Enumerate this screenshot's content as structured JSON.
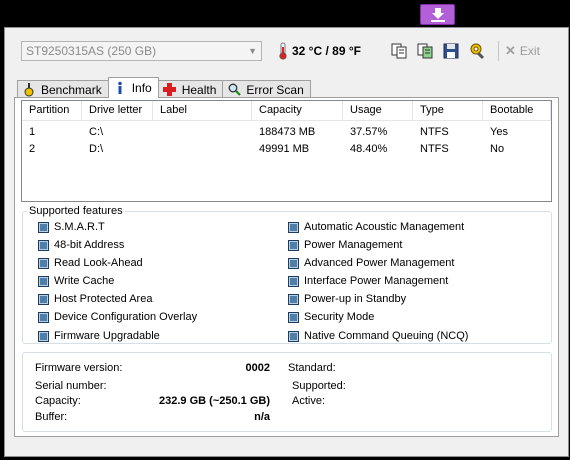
{
  "drive": {
    "selected": "ST9250315AS (250 GB)"
  },
  "temperature": {
    "text": "32 °C / 89 °F"
  },
  "toolbar": {
    "exit_label": "Exit"
  },
  "tabs": [
    {
      "label": "Benchmark",
      "icon": "stopwatch-icon",
      "active": false
    },
    {
      "label": "Info",
      "icon": "info-icon",
      "active": true
    },
    {
      "label": "Health",
      "icon": "health-cross-icon",
      "active": false
    },
    {
      "label": "Error Scan",
      "icon": "magnifier-icon",
      "active": false
    }
  ],
  "partitions": {
    "columns": [
      "Partition",
      "Drive letter",
      "Label",
      "Capacity",
      "Usage",
      "Type",
      "Bootable"
    ],
    "rows": [
      [
        "1",
        "C:\\",
        "",
        "188473 MB",
        "37.57%",
        "NTFS",
        "Yes"
      ],
      [
        "2",
        "D:\\",
        "",
        "49991 MB",
        "48.40%",
        "NTFS",
        "No"
      ]
    ]
  },
  "features": {
    "title": "Supported features",
    "left": [
      "S.M.A.R.T",
      "48-bit Address",
      "Read Look-Ahead",
      "Write Cache",
      "Host Protected Area",
      "Device Configuration Overlay",
      "Firmware Upgradable"
    ],
    "right": [
      "Automatic Acoustic Management",
      "Power Management",
      "Advanced Power Management",
      "Interface Power Management",
      "Power-up in Standby",
      "Security Mode",
      "Native Command Queuing (NCQ)"
    ]
  },
  "details": {
    "firmware_label": "Firmware version:",
    "firmware_value": "0002",
    "serial_label": "Serial number:",
    "serial_value": "",
    "capacity_label": "Capacity:",
    "capacity_value": "232.9 GB (~250.1 GB)",
    "buffer_label": "Buffer:",
    "buffer_value": "n/a",
    "standard_label": "Standard:",
    "supported_label": "Supported:",
    "active_label": "Active:"
  },
  "colors": {
    "download_button": "#b25fd8",
    "checkbox": "#4f7ea9",
    "background": "#f0f0f0"
  }
}
